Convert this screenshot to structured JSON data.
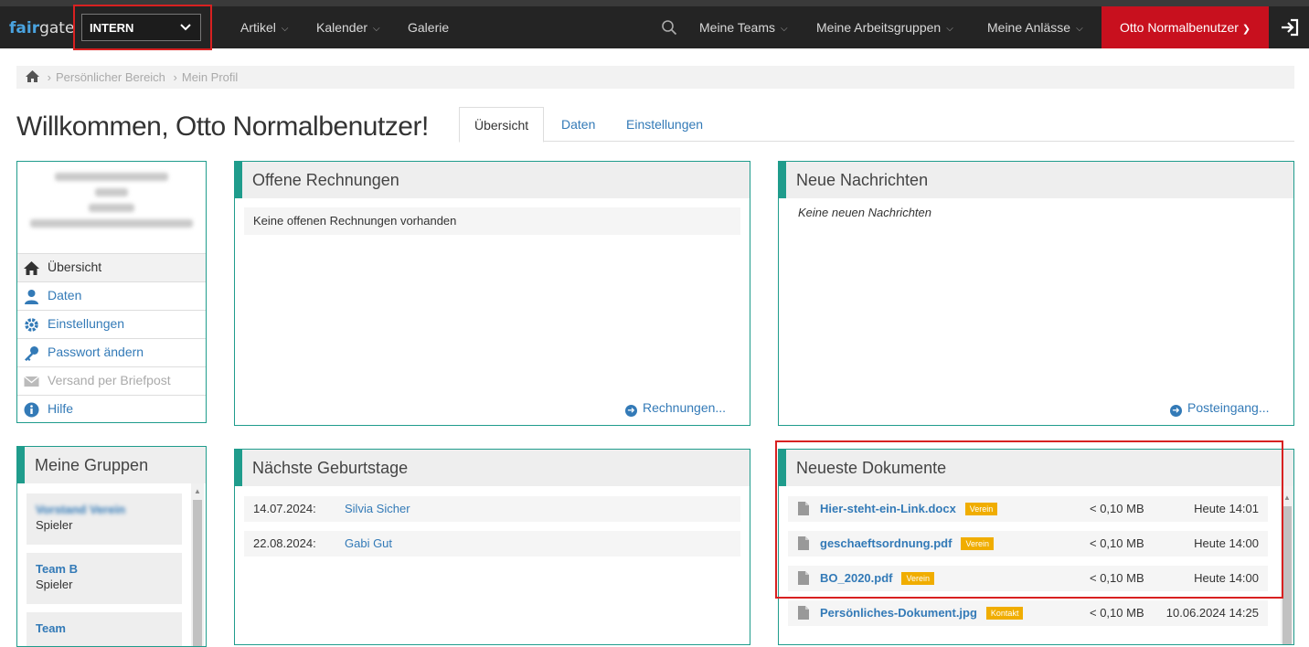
{
  "app": {
    "logo_part1": "fair",
    "logo_part2": "gate"
  },
  "topbar": {
    "context_select": "INTERN",
    "nav": [
      "Artikel",
      "Kalender",
      "Galerie"
    ],
    "right_nav": [
      "Meine Teams",
      "Meine Arbeitsgruppen",
      "Meine Anlässe"
    ],
    "user_name": "Otto Normalbenutzer"
  },
  "breadcrumb": [
    "Persönlicher Bereich",
    "Mein Profil"
  ],
  "page": {
    "title": "Willkommen, Otto Normalbenutzer!"
  },
  "tabs": [
    "Übersicht",
    "Daten",
    "Einstellungen"
  ],
  "sidebar": {
    "items": [
      {
        "label": "Übersicht",
        "icon": "home-icon"
      },
      {
        "label": "Daten",
        "icon": "user-icon"
      },
      {
        "label": "Einstellungen",
        "icon": "gear-icon"
      },
      {
        "label": "Passwort ändern",
        "icon": "key-icon"
      },
      {
        "label": "Versand per Briefpost",
        "icon": "envelope-icon"
      },
      {
        "label": "Hilfe",
        "icon": "info-icon"
      }
    ]
  },
  "rechnungen": {
    "title": "Offene Rechnungen",
    "empty": "Keine offenen Rechnungen vorhanden",
    "link": "Rechnungen..."
  },
  "nachrichten": {
    "title": "Neue Nachrichten",
    "empty": "Keine neuen Nachrichten",
    "link": "Posteingang..."
  },
  "gruppen": {
    "title": "Meine Gruppen",
    "items": [
      {
        "name": "Vorstand Verein",
        "role": "Spieler"
      },
      {
        "name": "Team B",
        "role": "Spieler"
      },
      {
        "name": "Team"
      }
    ]
  },
  "geburtstage": {
    "title": "Nächste Geburtstage",
    "rows": [
      {
        "date": "14.07.2024:",
        "name": "Silvia Sicher"
      },
      {
        "date": "22.08.2024:",
        "name": "Gabi Gut"
      }
    ]
  },
  "dokumente": {
    "title": "Neueste Dokumente",
    "rows": [
      {
        "name": "Hier-steht-ein-Link.docx",
        "badge": "Verein",
        "size": "< 0,10 MB",
        "date": "Heute 14:01"
      },
      {
        "name": "geschaeftsordnung.pdf",
        "badge": "Verein",
        "size": "< 0,10 MB",
        "date": "Heute 14:00"
      },
      {
        "name": "BO_2020.pdf",
        "badge": "Verein",
        "size": "< 0,10 MB",
        "date": "Heute 14:00"
      },
      {
        "name": "Persönliches-Dokument.jpg",
        "badge": "Kontakt",
        "size": "< 0,10 MB",
        "date": "10.06.2024 14:25"
      }
    ]
  },
  "colors": {
    "accent": "#1f9c8c",
    "brand_red": "#c8101e",
    "link": "#337ab7",
    "badge": "#f0ad00",
    "highlight_box": "#d82121"
  }
}
